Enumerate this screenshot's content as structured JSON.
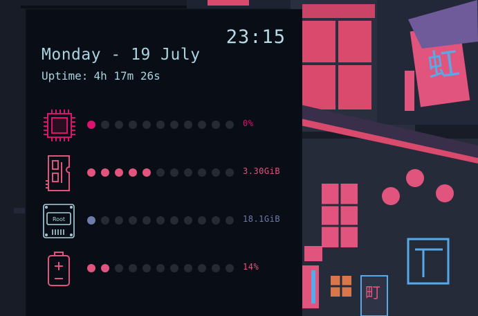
{
  "clock": {
    "time": "23:15"
  },
  "date": {
    "text": "Monday - 19 July"
  },
  "uptime": {
    "label": "Uptime:",
    "hours": "4h",
    "minutes": "17m",
    "seconds": "26s"
  },
  "colors": {
    "accent_pink": "#e1547d",
    "cpu_magenta": "#d9136e",
    "disk_blue": "#6e7cab",
    "inactive_dot": "#252a33",
    "text_cyan": "#a9d3de",
    "panel_bg": "#090d15"
  },
  "stats": [
    {
      "name": "cpu",
      "icon": "cpu-chip-icon",
      "dots_total": 11,
      "dots_active": 1,
      "value": "0%",
      "color": "#d9136e"
    },
    {
      "name": "memory",
      "icon": "ram-stick-icon",
      "dots_total": 11,
      "dots_active": 5,
      "value": "3.30GiB",
      "color": "#e1547d"
    },
    {
      "name": "disk",
      "icon": "hard-disk-icon",
      "dots_total": 11,
      "dots_active": 1,
      "value": "18.1GiB",
      "color": "#6e7cab",
      "disk_label": "Root"
    },
    {
      "name": "battery",
      "icon": "battery-icon",
      "dots_total": 11,
      "dots_active": 2,
      "value": "14%",
      "color": "#e1547d"
    }
  ]
}
